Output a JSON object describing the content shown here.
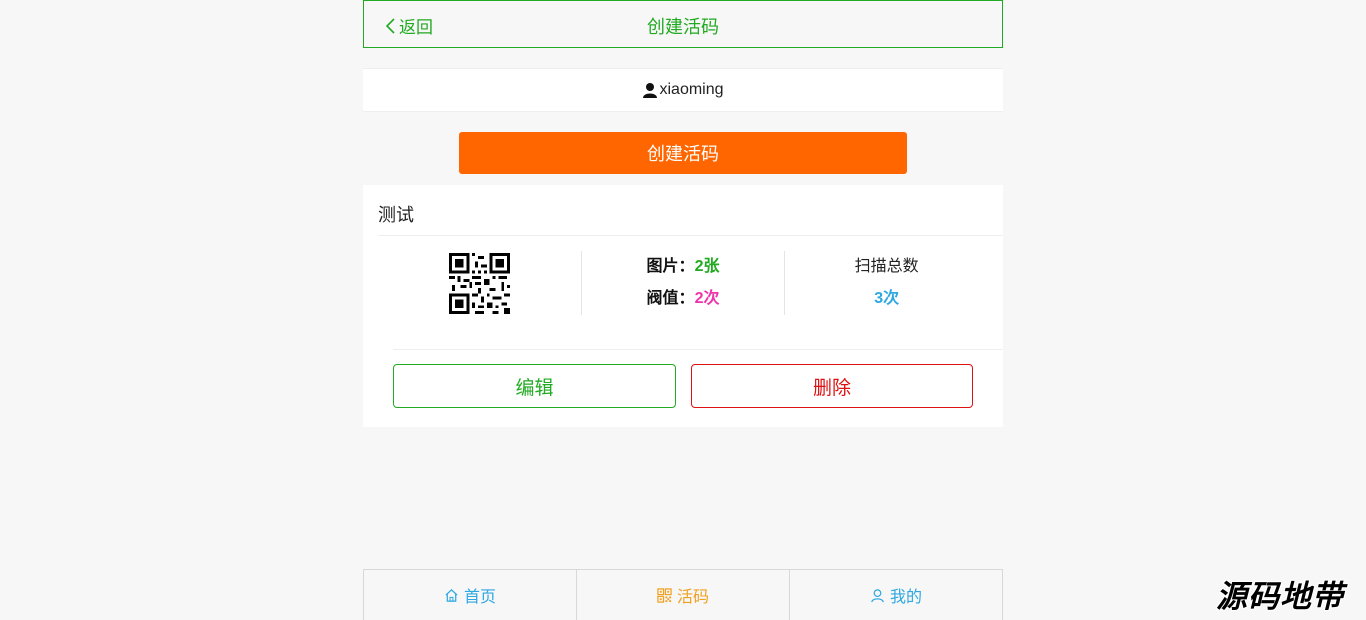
{
  "header": {
    "back_label": "返回",
    "title": "创建活码"
  },
  "user": {
    "username": "xiaoming"
  },
  "create_button_label": "创建活码",
  "card": {
    "title": "测试",
    "images_label": "图片：",
    "images_value": "2张",
    "threshold_label": "阀值：",
    "threshold_value": "2次",
    "scan_label": "扫描总数",
    "scan_value": "3次",
    "edit_label": "编辑",
    "delete_label": "删除"
  },
  "tabs": [
    {
      "label": "首页",
      "icon": "home-icon",
      "color": "#2ea8e0"
    },
    {
      "label": "活码",
      "icon": "qrcode-icon",
      "color": "#f0a020"
    },
    {
      "label": "我的",
      "icon": "user-icon",
      "color": "#2ea8e0"
    }
  ],
  "watermark": "源码地带",
  "colors": {
    "accent_green": "#22aa22",
    "accent_orange": "#ff6600",
    "danger_red": "#dd1111",
    "threshold_pink": "#ee33aa",
    "scan_blue": "#2ea8e0"
  }
}
